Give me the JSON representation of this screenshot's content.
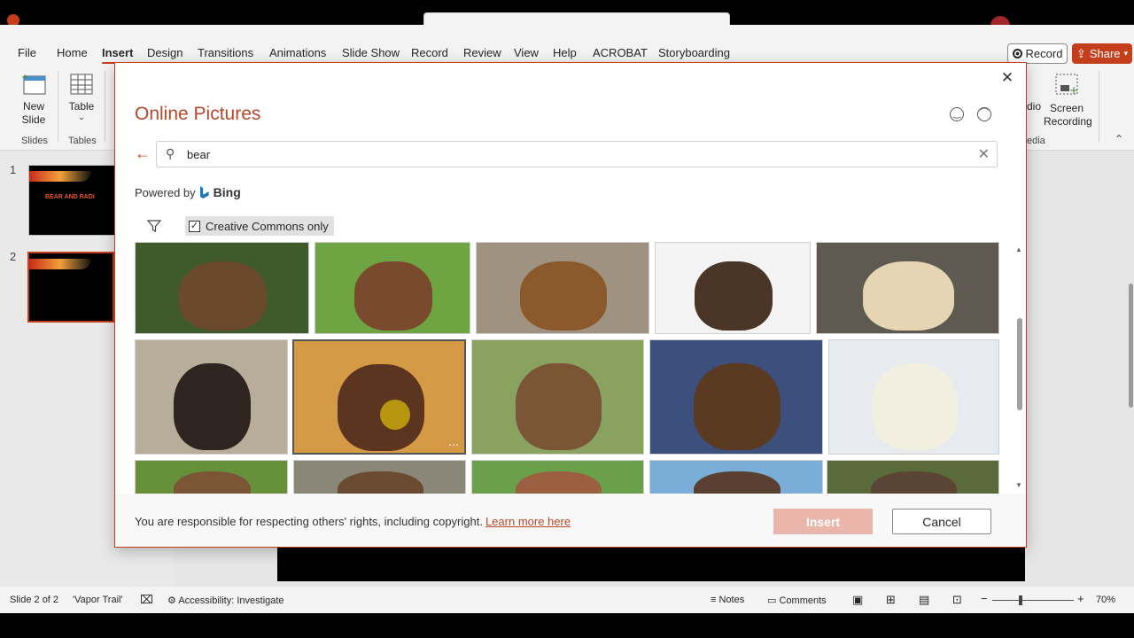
{
  "menu": [
    "File",
    "Home",
    "Insert",
    "Design",
    "Transitions",
    "Animations",
    "Slide Show",
    "Record",
    "Review",
    "View",
    "Help",
    "ACROBAT",
    "Storyboarding"
  ],
  "menu_active": "Insert",
  "record_label": "Record",
  "share_label": "Share",
  "ribbon": {
    "new_slide": "New\nSlide",
    "table": "Table",
    "group_slides": "Slides",
    "group_tables": "Tables",
    "audio_partial": "dio",
    "screen_recording": "Screen\nRecording",
    "group_media_partial": "edia"
  },
  "slides": {
    "num1": "1",
    "num2": "2",
    "thumb1_title": "BEAR AND RADI"
  },
  "dialog": {
    "title": "Online Pictures",
    "search_value": "bear",
    "powered_by": "Powered by",
    "bing": "Bing",
    "creative_commons": "Creative Commons only",
    "creative_commons_checked": true,
    "notice": "You are responsible for respecting others' rights, including copyright.",
    "learn_more": "Learn more here",
    "insert": "Insert",
    "cancel": "Cancel"
  },
  "images": [
    {
      "name": "bear-image-1",
      "bg": "#3f5a2b",
      "bear": "#6b4a2c"
    },
    {
      "name": "bear-image-2",
      "bg": "#6ea441",
      "bear": "#7a4a2e"
    },
    {
      "name": "bear-image-3",
      "bg": "#9f9280",
      "bear": "#8a5a2c"
    },
    {
      "name": "bear-image-4",
      "bg": "#f3f3f3",
      "bear": "#4a3526"
    },
    {
      "name": "bear-image-5",
      "bg": "#5e5a52",
      "bear": "#e6d5b3"
    },
    {
      "name": "bear-image-6",
      "bg": "#b7ad9a",
      "bear": "#2e2520"
    },
    {
      "name": "bear-image-7",
      "bg": "#d59a45",
      "bear": "#5b3520"
    },
    {
      "name": "bear-image-8",
      "bg": "#8aa260",
      "bear": "#7a5636"
    },
    {
      "name": "bear-image-9",
      "bg": "#3d4f7d",
      "bear": "#5b3a22"
    },
    {
      "name": "bear-image-10",
      "bg": "#e7eaef",
      "bear": "#f2eee0"
    },
    {
      "name": "bear-image-11",
      "bg": "#66903a",
      "bear": "#7a5536"
    },
    {
      "name": "bear-image-12",
      "bg": "#8a8678",
      "bear": "#6a4a30"
    },
    {
      "name": "bear-image-13",
      "bg": "#6aa04a",
      "bear": "#9a6040"
    },
    {
      "name": "bear-image-14",
      "bg": "#7aaed8",
      "bear": "#5a4030"
    },
    {
      "name": "bear-image-15",
      "bg": "#5a6a3a",
      "bear": "#5a4535"
    }
  ],
  "status": {
    "slide_of": "Slide 2 of 2",
    "theme": "'Vapor Trail'",
    "accessibility": "Accessibility: Investigate",
    "notes": "Notes",
    "comments": "Comments",
    "zoom": "70%"
  },
  "colors": {
    "accent": "#c43e1c",
    "title": "#b7472a"
  }
}
